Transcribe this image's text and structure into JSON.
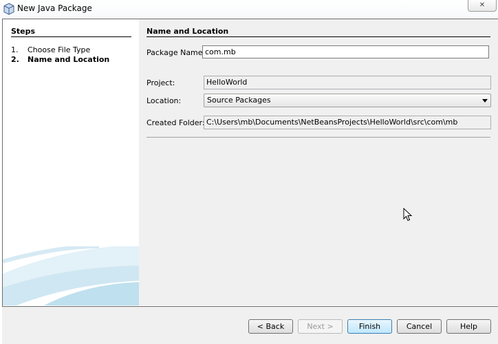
{
  "window": {
    "title": "New Java Package",
    "close_glyph": "✕"
  },
  "steps": {
    "title": "Steps",
    "items": [
      {
        "num": "1.",
        "label": "Choose File Type"
      },
      {
        "num": "2.",
        "label": "Name and Location"
      }
    ]
  },
  "panel": {
    "title": "Name and Location",
    "package_name_label": "Package Name:",
    "package_name_value": "com.mb",
    "project_label": "Project:",
    "project_value": "HelloWorld",
    "location_label": "Location:",
    "location_value": "Source Packages",
    "created_folder_label": "Created Folder:",
    "created_folder_value": "C:\\Users\\mb\\Documents\\NetBeansProjects\\HelloWorld\\src\\com\\mb"
  },
  "buttons": {
    "back": "< Back",
    "next": "Next >",
    "finish": "Finish",
    "cancel": "Cancel",
    "help": "Help"
  },
  "icons": {
    "title": "java-package-icon",
    "close": "close-icon",
    "cursor": "mouse-pointer-icon",
    "dropdown": "chevron-down-icon"
  },
  "colors": {
    "accent": "#3c7fb1",
    "panel_bg": "#f0f0f0",
    "swoosh": "#bfe0ee"
  }
}
